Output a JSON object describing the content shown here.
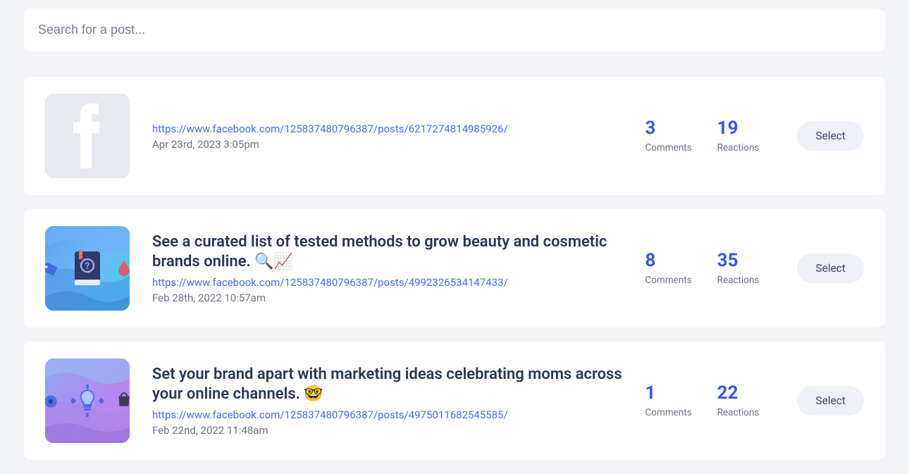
{
  "search": {
    "placeholder": "Search for a post..."
  },
  "labels": {
    "comments": "Comments",
    "reactions": "Reactions",
    "select": "Select"
  },
  "posts": [
    {
      "title": "",
      "url": "https://www.facebook.com/125837480796387/posts/6217274814985926/",
      "date": "Apr 23rd, 2023 3:05pm",
      "comments": "3",
      "reactions": "19",
      "thumb_kind": "fb-placeholder"
    },
    {
      "title": "See a curated list of tested methods to grow beauty and cosmetic brands online. 🔍📈",
      "url": "https://www.facebook.com/125837480796387/posts/4992326534147433/",
      "date": "Feb 28th, 2022 10:57am",
      "comments": "8",
      "reactions": "35",
      "thumb_kind": "wave-book"
    },
    {
      "title": "Set your brand apart with marketing ideas celebrating moms across your online channels. 🤓",
      "url": "https://www.facebook.com/125837480796387/posts/4975011682545585/",
      "date": "Feb 22nd, 2022 11:48am",
      "comments": "1",
      "reactions": "22",
      "thumb_kind": "wave-bulb"
    }
  ]
}
